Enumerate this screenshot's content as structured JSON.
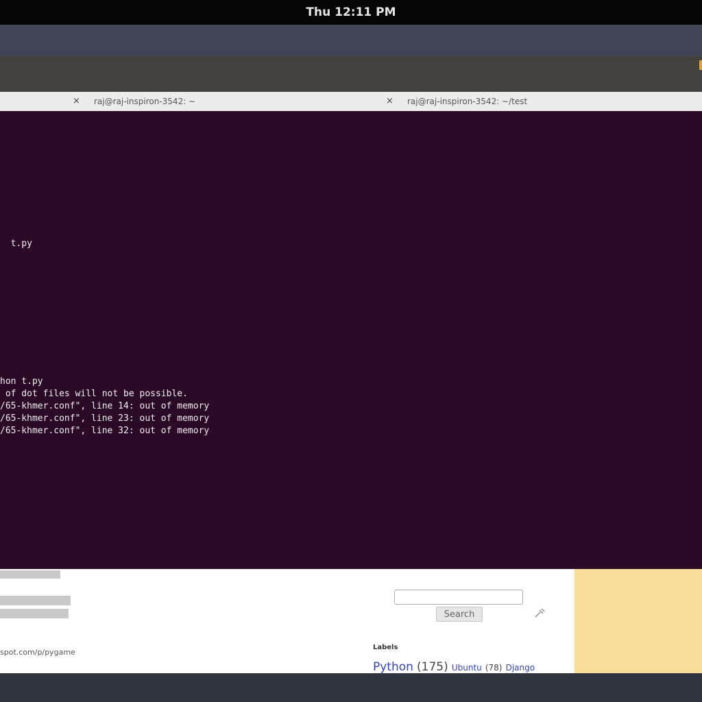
{
  "topbar": {
    "clock": "Thu 12:11 PM"
  },
  "terminal_tabs": [
    {
      "close_glyph": "×",
      "title": "raj@raj-inspiron-3542: ~"
    },
    {
      "close_glyph": "×",
      "title": "raj@raj-inspiron-3542: ~/test"
    }
  ],
  "terminal_lines": [
    "  t.py",
    "hon t.py",
    " of dot files will not be possible.",
    "/65-khmer.conf\", line 14: out of memory",
    "/65-khmer.conf\", line 23: out of memory",
    "/65-khmer.conf\", line 32: out of memory"
  ],
  "browser": {
    "url_text": "spot.com/p/pygame",
    "search_button_label": "Search",
    "labels_heading": "Labels",
    "labels": [
      {
        "name": "Python",
        "count": "(175)"
      },
      {
        "name": "Ubuntu",
        "count": "(78)"
      },
      {
        "name": "Django",
        "count": ""
      }
    ]
  },
  "colors": {
    "terminal_bg": "#2b0a27",
    "tabbar_bg": "#ececec",
    "topbar_bg": "#050505",
    "link": "#3344bb",
    "side_panel": "#f8dc98"
  }
}
